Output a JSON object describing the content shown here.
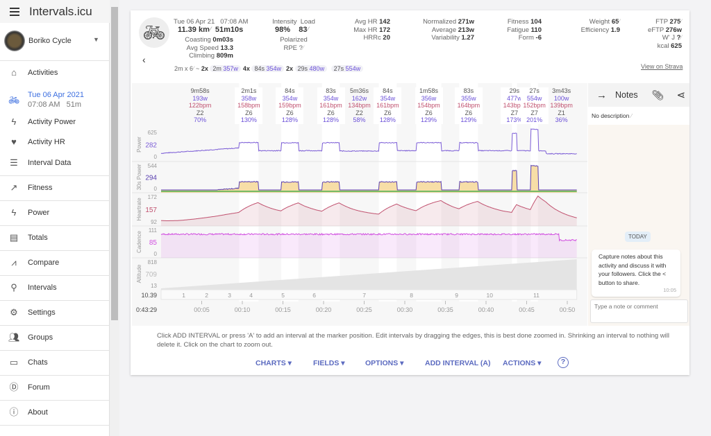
{
  "app": {
    "title": "Intervals.icu"
  },
  "athlete": {
    "name": "Boriko Cycle"
  },
  "sidebar": {
    "items": [
      {
        "label": "Activities",
        "icon": "home-icon"
      },
      {
        "label": "Tue 06 Apr 2021",
        "sub": "07:08 AM   51m",
        "icon": "bike-icon",
        "active": true
      },
      {
        "label": "Activity Power",
        "icon": "bolt-icon"
      },
      {
        "label": "Activity HR",
        "icon": "heart-icon"
      },
      {
        "label": "Interval Data",
        "icon": "list-icon"
      },
      {
        "label": "Fitness",
        "icon": "trend-icon"
      },
      {
        "label": "Power",
        "icon": "bolt-icon"
      },
      {
        "label": "Totals",
        "icon": "totals-icon"
      },
      {
        "label": "Compare",
        "icon": "compare-icon"
      },
      {
        "label": "Intervals",
        "icon": "search-icon"
      },
      {
        "label": "Settings",
        "icon": "gear-icon"
      },
      {
        "label": "Groups",
        "icon": "group-icon"
      },
      {
        "label": "Chats",
        "icon": "chat-icon"
      },
      {
        "label": "Forum",
        "icon": "forum-icon"
      },
      {
        "label": "About",
        "icon": "info-icon"
      }
    ]
  },
  "activity": {
    "date": "Tue 06 Apr 21",
    "time": "07:08 AM",
    "distance": "11.39 km",
    "duration": "51m10s",
    "coasting": "0m03s",
    "avg_speed": "13.3",
    "climbing": "809m",
    "intensity": "98%",
    "load": "83",
    "polarized": "Polarized",
    "rpe": "?",
    "avg_hr": "142",
    "max_hr": "172",
    "hrrc": "20",
    "normalized": "271w",
    "average": "213w",
    "variability": "1.27",
    "fitness": "104",
    "fatigue": "110",
    "form": "-6",
    "weight": "65",
    "efficiency": "1.9",
    "ftp": "275",
    "eftp": "276w",
    "wprime": "?",
    "kcal": "625",
    "labels": {
      "coasting": "Coasting",
      "avg_speed": "Avg Speed",
      "climbing": "Climbing",
      "intensity": "Intensity",
      "load": "Load",
      "rpe": "RPE",
      "avg_hr": "Avg HR",
      "max_hr": "Max HR",
      "hrrc": "HRRc",
      "normalized": "Normalized",
      "average": "Average",
      "variability": "Variability",
      "fitness": "Fitness",
      "fatigue": "Fatigue",
      "form": "Form",
      "weight": "Weight",
      "efficiency": "Efficiency",
      "ftp": "FTP",
      "eftp": "eFTP",
      "wprime": "W' J",
      "kcal": "kcal"
    },
    "strava_link": "View on Strava",
    "summary": {
      "prefix": "2m x 6",
      "tilde": "~",
      "groups": [
        {
          "n": "2x",
          "d": "2m",
          "w": "357w"
        },
        {
          "n": "4x",
          "d": "84s",
          "w": "354w"
        },
        {
          "n": "2x",
          "d": "29s",
          "w": "480w"
        },
        {
          "n": "",
          "d": "27s",
          "w": "554w"
        }
      ]
    }
  },
  "intervals": [
    {
      "dur": "9m58s",
      "w": "193w",
      "hr": "122bpm",
      "z": "Z2",
      "pct": "70%",
      "start": 0,
      "end": 9.6,
      "hi": false
    },
    {
      "dur": "2m1s",
      "w": "358w",
      "hr": "158bpm",
      "z": "Z6",
      "pct": "130%",
      "start": 9.6,
      "end": 12.0,
      "hi": true
    },
    {
      "dur": "84s",
      "w": "354w",
      "hr": "159bpm",
      "z": "Z6",
      "pct": "128%",
      "start": 14.8,
      "end": 16.9,
      "hi": true
    },
    {
      "dur": "83s",
      "w": "354w",
      "hr": "161bpm",
      "z": "Z6",
      "pct": "128%",
      "start": 19.8,
      "end": 22.0,
      "hi": true
    },
    {
      "dur": "5m36s",
      "w": "162w",
      "hr": "134bpm",
      "z": "Z2",
      "pct": "58%",
      "start": 22.0,
      "end": 26.8,
      "hi": false
    },
    {
      "dur": "84s",
      "w": "354w",
      "hr": "161bpm",
      "z": "Z6",
      "pct": "128%",
      "start": 26.8,
      "end": 29.0,
      "hi": true
    },
    {
      "dur": "1m58s",
      "w": "356w",
      "hr": "154bpm",
      "z": "Z6",
      "pct": "129%",
      "start": 31.4,
      "end": 34.5,
      "hi": true
    },
    {
      "dur": "83s",
      "w": "355w",
      "hr": "164bpm",
      "z": "Z6",
      "pct": "129%",
      "start": 36.7,
      "end": 39.0,
      "hi": true
    },
    {
      "dur": "29s",
      "w": "477w",
      "hr": "143bpm",
      "z": "Z7",
      "pct": "173%",
      "start": 43.2,
      "end": 43.8,
      "hi": true
    },
    {
      "dur": "27s",
      "w": "554w",
      "hr": "152bpm",
      "z": "Z7",
      "pct": "201%",
      "start": 45.5,
      "end": 46.4,
      "hi": true
    },
    {
      "dur": "3m43s",
      "w": "100w",
      "hr": "139bpm",
      "z": "Z1",
      "pct": "36%",
      "start": 47.4,
      "end": 51.17,
      "hi": false
    }
  ],
  "chart_data": {
    "type": "line",
    "lanes": [
      {
        "name": "Power",
        "ticks": [
          "625",
          "282",
          "0"
        ],
        "range": [
          0,
          625
        ],
        "color": "#7b5cd6"
      },
      {
        "name": "30s Power",
        "ticks": [
          "544",
          "294",
          "0"
        ],
        "range": [
          0,
          544
        ],
        "color": "#5a3fb0"
      },
      {
        "name": "Heartrate",
        "ticks": [
          "172",
          "157",
          "92"
        ],
        "range": [
          92,
          172
        ],
        "color": "#c0506e"
      },
      {
        "name": "Cadence",
        "ticks": [
          "111",
          "85",
          "0"
        ],
        "range": [
          0,
          111
        ],
        "color": "#d14ee0"
      },
      {
        "name": "Altitude",
        "ticks": [
          "818",
          "709",
          "13"
        ],
        "range": [
          13,
          818
        ],
        "color": "#bbbbbb"
      }
    ],
    "x_ticks": [
      "00:05",
      "00:10",
      "00:15",
      "00:20",
      "00:25",
      "00:30",
      "00:35",
      "00:40",
      "00:45",
      "00:50"
    ],
    "x_range_min": [
      0,
      51.17
    ],
    "lap_value": "10.39",
    "time_value": "0:43:29",
    "laps": [
      "1",
      "2",
      "3",
      "4",
      "5",
      "6",
      "7",
      "8",
      "9",
      "10",
      "11"
    ]
  },
  "help_text": "Click ADD INTERVAL or press 'A' to add an interval at the marker position. Edit intervals by dragging the edges, this is best done zoomed in. Shrinking an interval to nothing will delete it. Click on the chart to zoom out.",
  "actions": {
    "charts": "CHARTS",
    "fields": "FIELDS",
    "options": "OPTIONS",
    "add_interval": "ADD INTERVAL (A)",
    "actions": "ACTIONS",
    "help": "?"
  },
  "notes": {
    "title": "Notes",
    "description": "No description",
    "today": "TODAY",
    "message": "Capture notes about this activity and discuss it with your followers. Click the < button to share.",
    "message_time": "10:05",
    "input_placeholder": "Type a note or comment"
  }
}
